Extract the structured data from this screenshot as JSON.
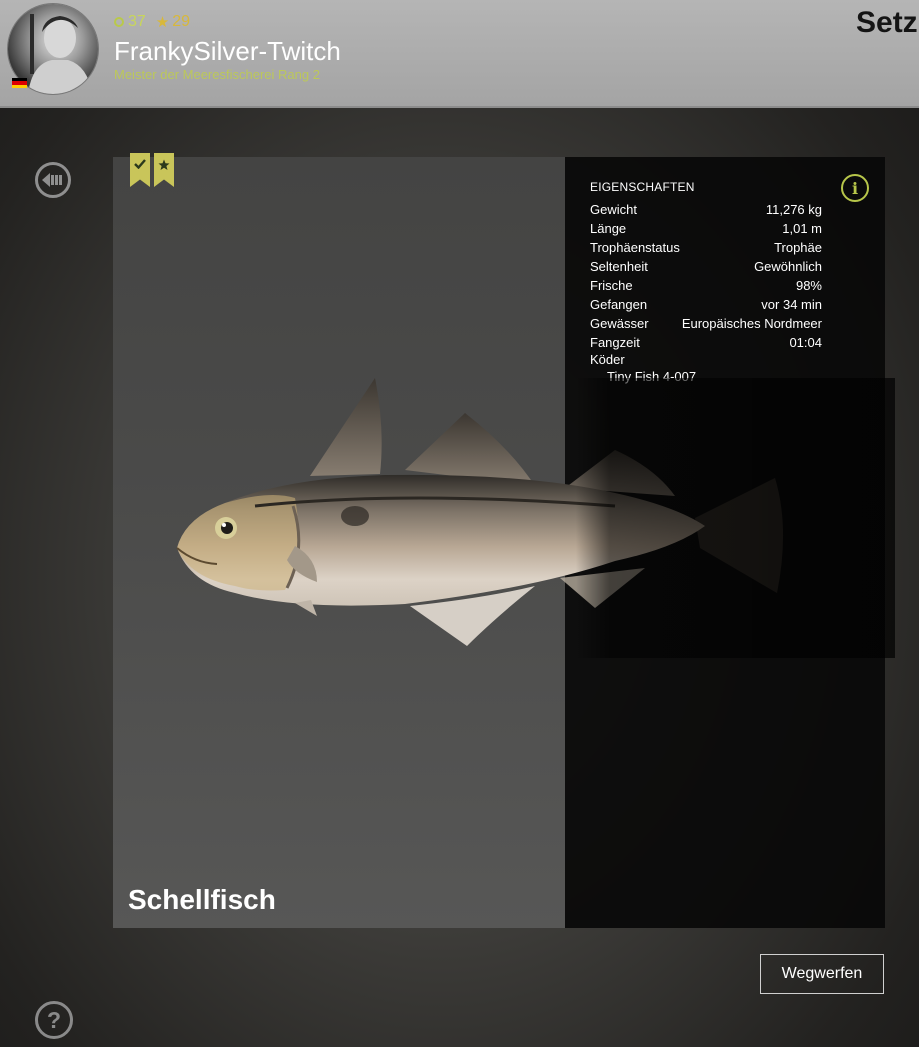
{
  "header": {
    "level": "37",
    "stars": "29",
    "username": "FrankySilver-Twitch",
    "rank": "Meister der Meeresfischerei Rang 2",
    "page_heading": "Setz"
  },
  "card": {
    "fish_name": "Schellfisch",
    "bookmarks": [
      "check-icon",
      "star-icon"
    ]
  },
  "properties": {
    "title": "EIGENSCHAFTEN",
    "rows": [
      {
        "label": "Gewicht",
        "value": "11,276 kg"
      },
      {
        "label": "Länge",
        "value": "1,01 m"
      },
      {
        "label": "Trophäenstatus",
        "value": "Trophäe"
      },
      {
        "label": "Seltenheit",
        "value": "Gewöhnlich"
      },
      {
        "label": "Frische",
        "value": "98%"
      },
      {
        "label": "Gefangen",
        "value": "vor 34 min"
      },
      {
        "label": "Gewässer",
        "value": "Europäisches Nordmeer"
      },
      {
        "label": "Fangzeit",
        "value": "01:04"
      }
    ],
    "bait_label": "Köder",
    "bait_value": "Tiny Fish 4-007"
  },
  "actions": {
    "discard_label": "Wegwerfen"
  },
  "icons": {
    "info": "i",
    "help": "?"
  },
  "colors": {
    "accent_green": "#b7c64a",
    "bookmark_yellow": "#c9c55a",
    "header_bg": "#aeaeae"
  }
}
